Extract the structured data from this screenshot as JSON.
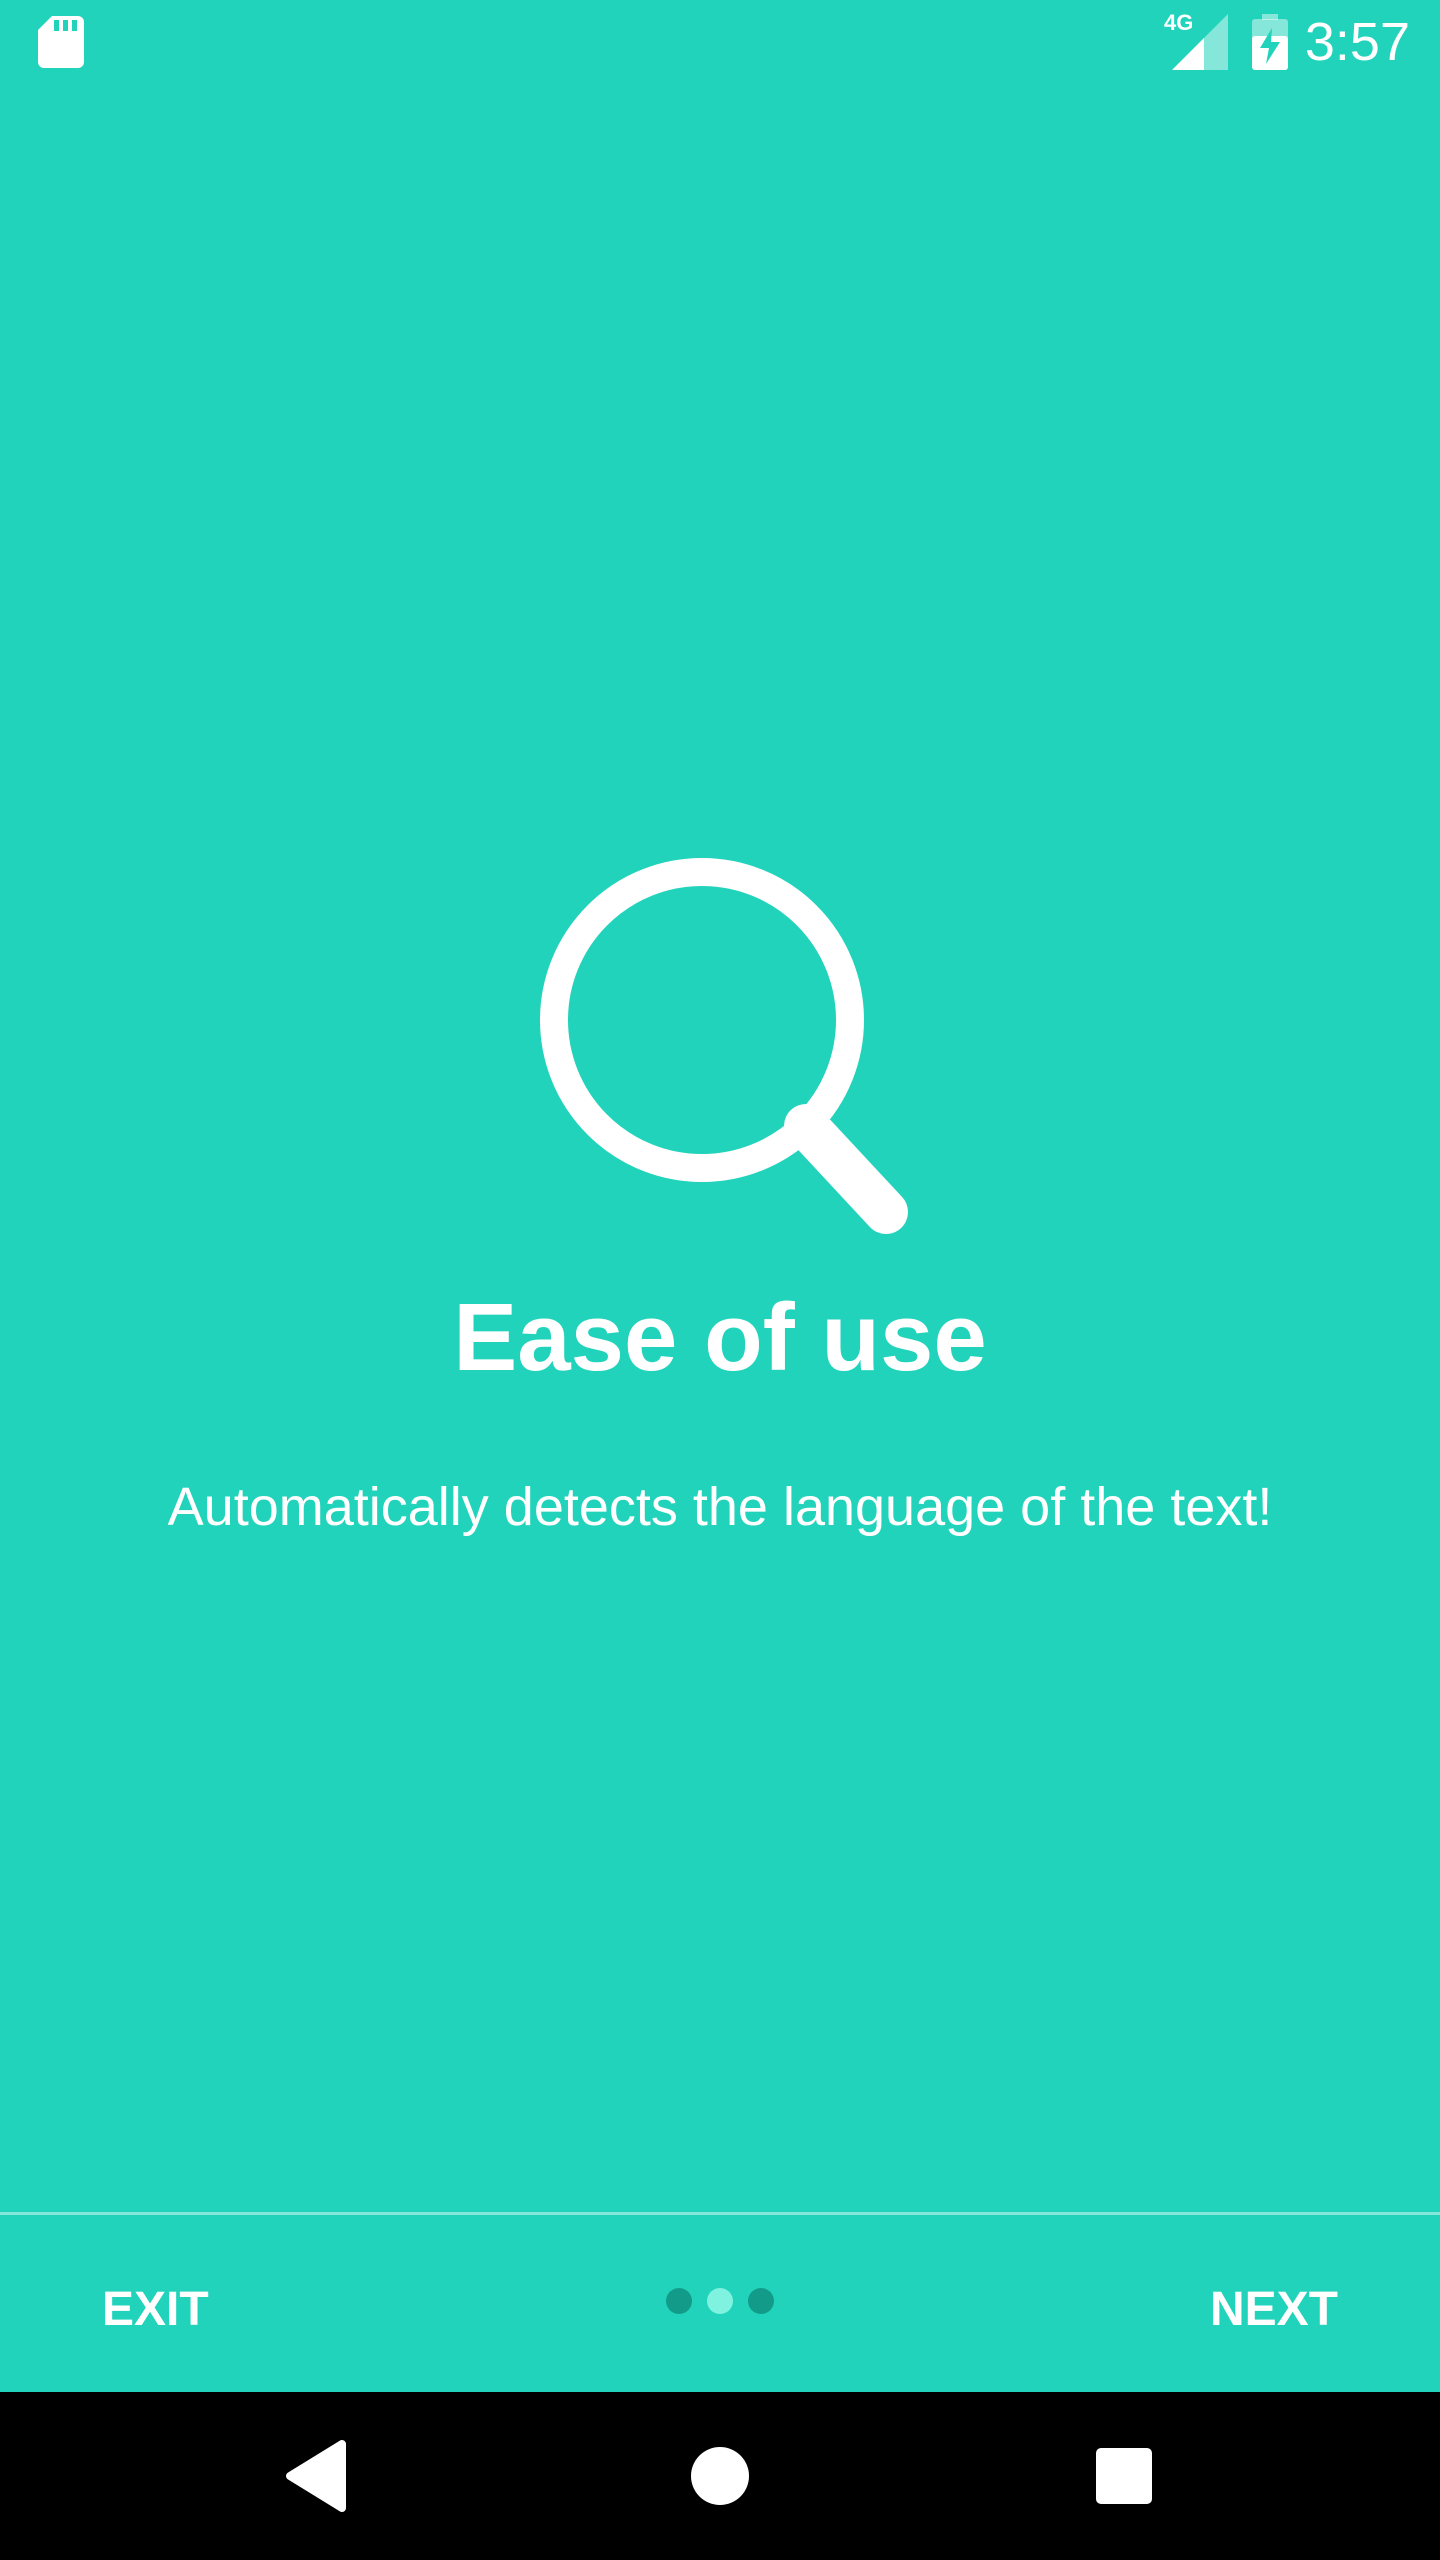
{
  "status_bar": {
    "network_label": "4G",
    "time": "3:57",
    "icons": [
      "sd-card-icon",
      "signal-icon",
      "battery-charging-icon"
    ]
  },
  "onboarding": {
    "icon": "search-icon",
    "title": "Ease of use",
    "description": "Automatically detects the language of the text!"
  },
  "footer": {
    "exit_label": "EXIT",
    "next_label": "NEXT",
    "pages": 3,
    "current_page": 2
  },
  "nav_bar": {
    "icons": [
      "back-icon",
      "home-icon",
      "recents-icon"
    ]
  },
  "colors": {
    "background": "#22D3BC",
    "text": "#FFFFFF",
    "dot_active": "#7FF2E0",
    "dot_inactive": "#129B89",
    "nav_background": "#000000"
  }
}
